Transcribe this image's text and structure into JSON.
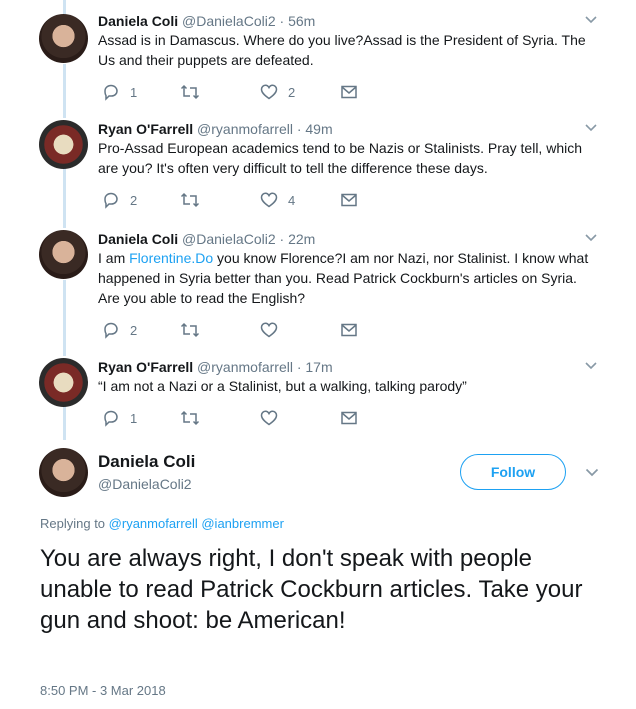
{
  "tweets": [
    {
      "name": "Daniela Coli",
      "handle": "@DanielaColi2",
      "time": "· 56m",
      "text": "Assad is in Damascus. Where do you live?Assad is the President of Syria. The Us and their puppets are defeated.",
      "replies": "1",
      "retweets": "",
      "likes": "2"
    },
    {
      "name": "Ryan O'Farrell",
      "handle": "@ryanmofarrell",
      "time": "· 49m",
      "text": "Pro-Assad European academics tend to be Nazis or Stalinists. Pray tell, which are you? It's often very difficult to tell the difference these days.",
      "replies": "2",
      "retweets": "",
      "likes": "4"
    },
    {
      "name": "Daniela Coli",
      "handle": "@DanielaColi2",
      "time": "· 22m",
      "text_prefix": "I am ",
      "text_link": "Florentine.Do",
      "text": " you know Florence?I am nor Nazi, nor Stalinist. I know what happened in Syria better than you. Read Patrick Cockburn's articles on Syria. Are you able to read the English?",
      "replies": "2",
      "retweets": "",
      "likes": ""
    },
    {
      "name": "Ryan O'Farrell",
      "handle": "@ryanmofarrell",
      "time": "· 17m",
      "text": "“I am not a Nazi or a Stalinist, but a walking, talking parody”",
      "replies": "1",
      "retweets": "",
      "likes": ""
    }
  ],
  "main": {
    "name": "Daniela Coli",
    "handle": "@DanielaColi2",
    "follow_label": "Follow",
    "replying_prefix": "Replying to",
    "replying_to_1": "@ryanmofarrell",
    "replying_to_2": "@ianbremmer",
    "text": "You are always right, I don't speak with people unable to read Patrick Cockburn articles. Take your gun and shoot: be American!",
    "timestamp": "8:50 PM - 3 Mar 2018"
  },
  "icons": {
    "reply": "reply-icon",
    "retweet": "retweet-icon",
    "like": "heart-icon",
    "dm": "envelope-icon",
    "more": "chevron-down-icon"
  },
  "colors": {
    "accent": "#1da1f2",
    "muted": "#657786",
    "thread_line": "#cfe3f2"
  }
}
